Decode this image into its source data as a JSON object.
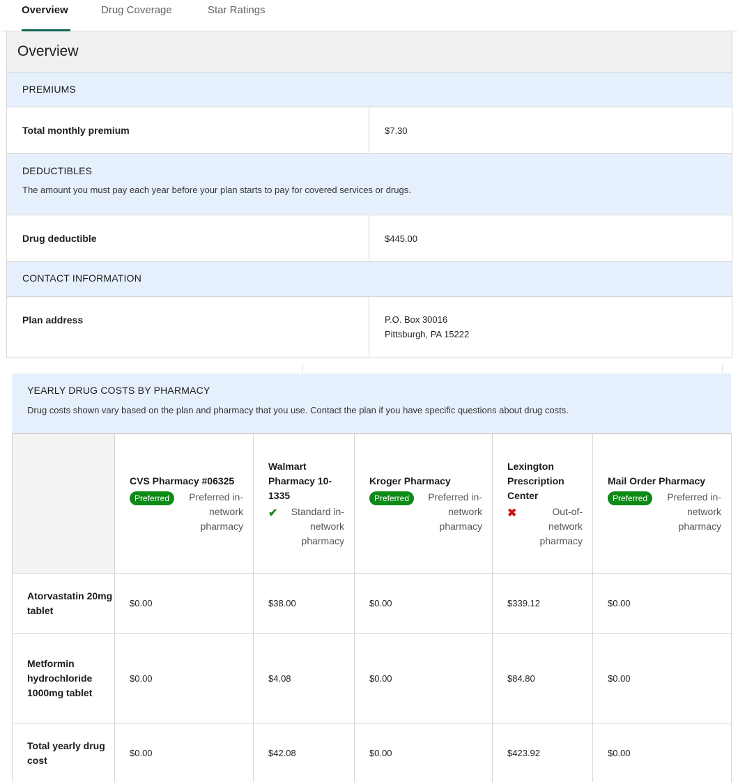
{
  "tabs": [
    "Overview",
    "Drug Coverage",
    "Star Ratings"
  ],
  "overview": {
    "title": "Overview",
    "premiums": {
      "heading": "PREMIUMS",
      "rows": [
        {
          "label": "Total monthly premium",
          "value": "$7.30"
        }
      ]
    },
    "deductibles": {
      "heading": "DEDUCTIBLES",
      "description": "The amount you must pay each year before your plan starts to pay for covered services or drugs.",
      "rows": [
        {
          "label": "Drug deductible",
          "value": "$445.00"
        }
      ]
    },
    "contact": {
      "heading": "CONTACT INFORMATION",
      "rows": [
        {
          "label": "Plan address",
          "line1": "P.O. Box 30016",
          "line2": "Pittsburgh, PA 15222"
        }
      ]
    }
  },
  "drug_costs": {
    "heading": "YEARLY DRUG COSTS BY PHARMACY",
    "description": "Drug costs shown vary based on the plan and pharmacy that you use. Contact the plan if you have specific questions about drug costs.",
    "pharmacies": [
      {
        "name": "CVS Pharmacy #06325",
        "badge": "Preferred",
        "network": "Preferred in-network pharmacy",
        "icon": "preferred-badge"
      },
      {
        "name": "Walmart Pharmacy 10-1335",
        "badge": "",
        "network": "Standard in-network pharmacy",
        "icon": "check-icon"
      },
      {
        "name": "Kroger Pharmacy",
        "badge": "Preferred",
        "network": "Preferred in-network pharmacy",
        "icon": "preferred-badge"
      },
      {
        "name": "Lexington Prescription Center",
        "badge": "",
        "network": "Out-of-network pharmacy",
        "icon": "x-icon"
      },
      {
        "name": "Mail Order Pharmacy",
        "badge": "Preferred",
        "network": "Preferred in-network pharmacy",
        "icon": "preferred-badge"
      }
    ],
    "rows": [
      {
        "label": "Atorvastatin 20mg tablet",
        "values": [
          "$0.00",
          "$38.00",
          "$0.00",
          "$339.12",
          "$0.00"
        ]
      },
      {
        "label": "Metformin hydrochloride 1000mg tablet",
        "values": [
          "$0.00",
          "$4.08",
          "$0.00",
          "$84.80",
          "$0.00"
        ]
      },
      {
        "label": "Total yearly drug cost",
        "values": [
          "$0.00",
          "$42.08",
          "$0.00",
          "$423.92",
          "$0.00"
        ]
      }
    ]
  },
  "colors": {
    "accent": "#0e6a54",
    "badge": "#0e8a16",
    "section_bg": "#e6f0fc",
    "check": "#148a2e",
    "x": "#c81a1a"
  }
}
